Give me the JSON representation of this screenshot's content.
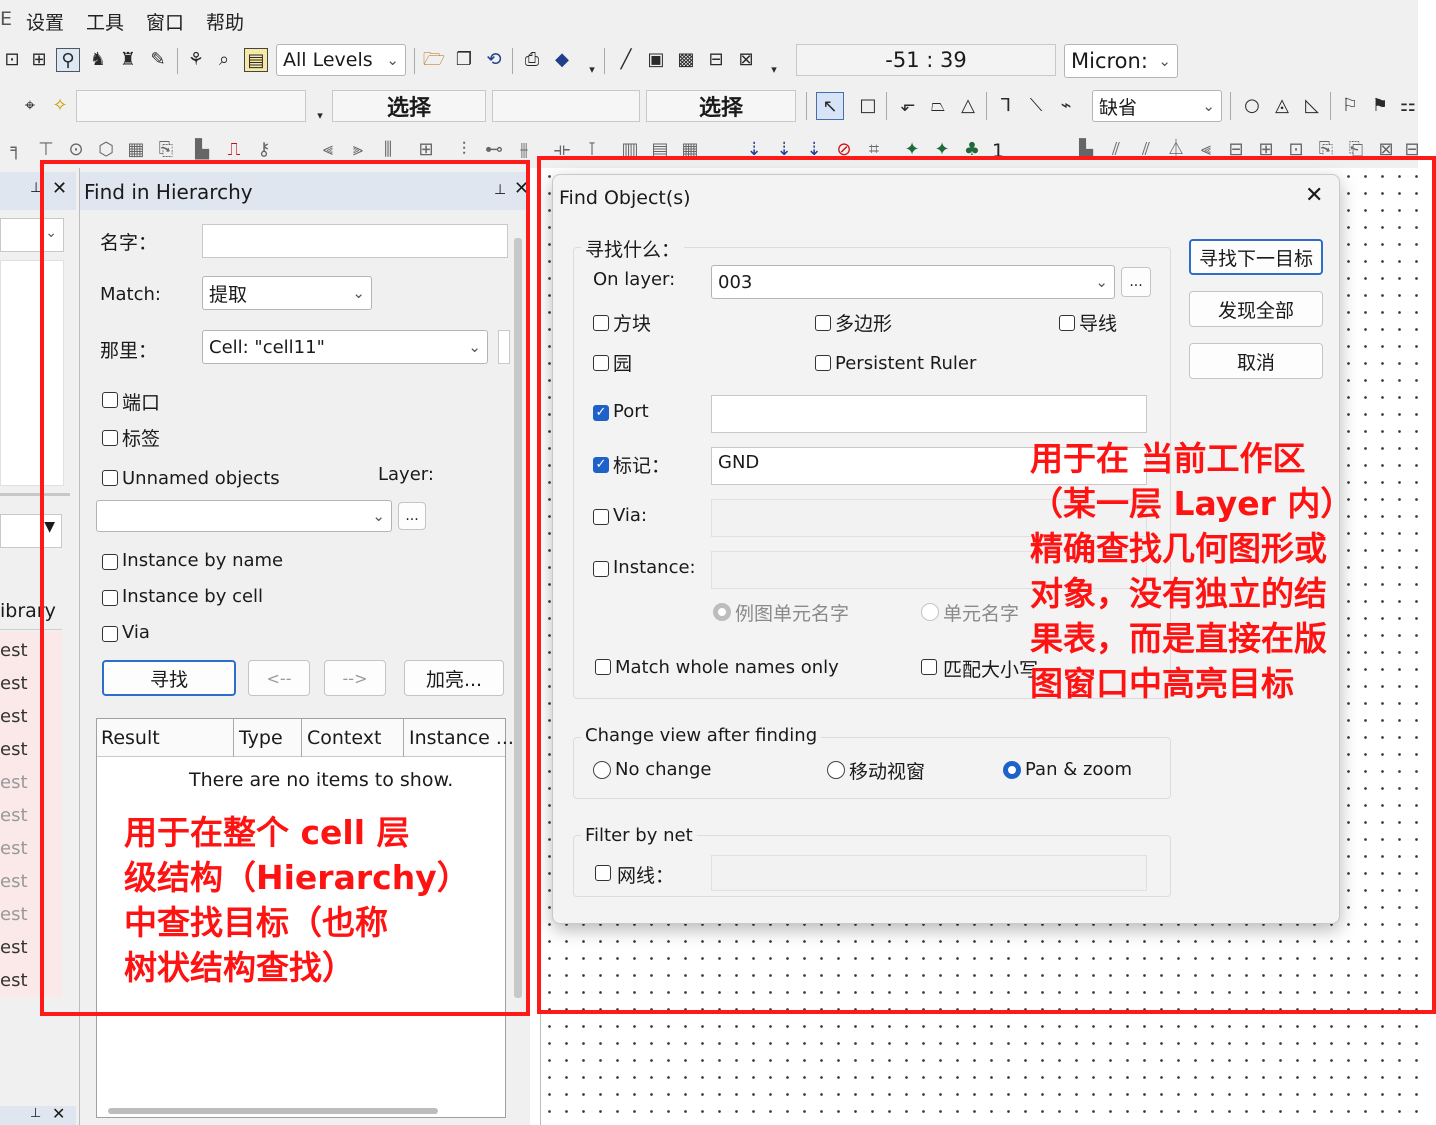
{
  "menu": {
    "items": [
      "设置",
      "工具",
      "窗口",
      "帮助"
    ]
  },
  "toolbar1": {
    "levels_combo": "All Levels",
    "coords": "-51 : 39",
    "units_combo": "Micron:"
  },
  "toolbar2": {
    "select_label_1": "选择",
    "select_label_2": "选择",
    "style_combo": "缺省"
  },
  "toolbar3": {
    "counter": "1"
  },
  "left_strip": {
    "library_header": "ibrary",
    "items": [
      "est",
      "est",
      "est",
      "est",
      "est",
      "est",
      "est",
      "est",
      "est",
      "est",
      "est"
    ]
  },
  "find_hierarchy": {
    "title": "Find in Hierarchy",
    "name_label": "名字：",
    "name_value": "",
    "match_label": "Match:",
    "match_value": "提取",
    "where_label": "那里：",
    "where_value": "Cell: \"cell11\"",
    "port_label": "端口",
    "tag_label": "标签",
    "unnamed_label": "Unnamed objects",
    "layer_label": "Layer:",
    "layer_value": "",
    "browse_label": "...",
    "inst_by_name_label": "Instance by name",
    "inst_by_cell_label": "Instance by cell",
    "via_label": "Via",
    "find_button": "寻找",
    "prev_button": "<--",
    "next_button": "-->",
    "highlight_button": "加亮...",
    "columns": [
      "Result",
      "Type",
      "Context",
      "Instance ..."
    ],
    "empty_text": "There are no items to show."
  },
  "find_objects": {
    "title": "Find Object(s)",
    "what_group": "寻找什么：",
    "on_layer_label": "On layer:",
    "on_layer_value": "003",
    "browse_label": "...",
    "box_label": "方块",
    "polygon_label": "多边形",
    "wire_label": "导线",
    "circle_label": "园",
    "ruler_label": "Persistent Ruler",
    "port_label": "Port",
    "port_value": "",
    "port_checked": true,
    "mark_label": "标记：",
    "mark_value": "GND",
    "mark_checked": true,
    "via_label": "Via:",
    "instance_label": "Instance:",
    "radio_instance_name": "例图单元名字",
    "radio_cell_name": "单元名字",
    "match_whole_label": "Match whole names only",
    "match_case_label": "匹配大小写",
    "view_group": "Change view after finding",
    "view_no_change": "No change",
    "view_move": "移动视窗",
    "view_pan_zoom": "Pan & zoom",
    "view_selected": "Pan & zoom",
    "net_group": "Filter by net",
    "net_label": "网线：",
    "find_next_button": "寻找下一目标",
    "find_all_button": "发现全部",
    "cancel_button": "取消"
  },
  "annotations": {
    "left": [
      "用于在整个 cell 层",
      "级结构（Hierarchy）",
      "中查找目标（也称",
      "树状结构查找）"
    ],
    "right": [
      "用于在 当前工作区",
      "（某一层 Layer 内）",
      "精确查找几何图形或",
      "对象，没有独立的结",
      "果表，而是直接在版",
      "图窗口中高亮目标"
    ]
  },
  "colors": {
    "annotation_red": "#ff1a1a",
    "accent_blue": "#1e62c9"
  },
  "icons": [
    "close-icon",
    "pin-icon",
    "chevron-down-icon",
    "checkmark-icon",
    "pointer-icon",
    "rectangle-icon",
    "polygon-icon",
    "triangle-icon",
    "circle-icon",
    "binoculars-icon",
    "magnifier-icon",
    "save-icon",
    "open-folder-icon"
  ]
}
